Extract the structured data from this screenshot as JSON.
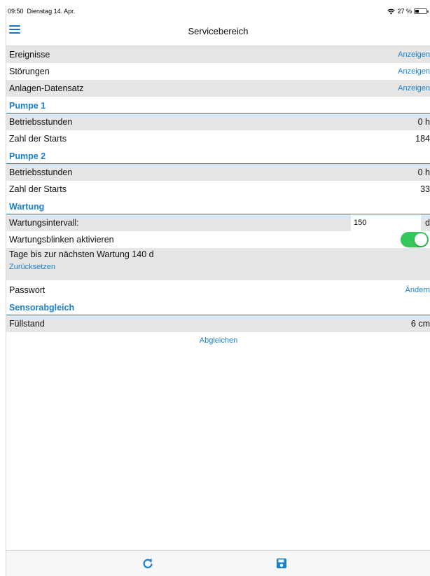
{
  "status_bar": {
    "time": "09:50",
    "date": "Dienstag 14. Apr.",
    "battery_text": "27 %",
    "battery_level": 0.27
  },
  "nav": {
    "title": "Servicebereich"
  },
  "top_rows": [
    {
      "label": "Ereignisse",
      "action": "Anzeigen"
    },
    {
      "label": "Störungen",
      "action": "Anzeigen"
    },
    {
      "label": "Anlagen-Datensatz",
      "action": "Anzeigen"
    }
  ],
  "pumpe1": {
    "title": "Pumpe 1",
    "betriebsstunden_label": "Betriebsstunden",
    "betriebsstunden_value": "0 h",
    "starts_label": "Zahl der Starts",
    "starts_value": "184"
  },
  "pumpe2": {
    "title": "Pumpe 2",
    "betriebsstunden_label": "Betriebsstunden",
    "betriebsstunden_value": "0 h",
    "starts_label": "Zahl der Starts",
    "starts_value": "33"
  },
  "wartung": {
    "title": "Wartung",
    "interval_label": "Wartungsintervall:",
    "interval_value": "150",
    "interval_unit": "d",
    "blink_label": "Wartungsblinken aktivieren",
    "blink_enabled": true,
    "next_text": "Tage bis zur nächsten Wartung 140 d",
    "reset_label": "Zurücksetzen"
  },
  "passwort": {
    "label": "Passwort",
    "action": "Ändern"
  },
  "sensor": {
    "title": "Sensorabgleich",
    "fill_label": "Füllstand",
    "fill_value": "6 cm",
    "calibrate_label": "Abgleichen"
  },
  "colors": {
    "accent": "#1a7fd0",
    "toggle_on": "#34c759",
    "row_grey": "#e5e5e5"
  },
  "icons": {
    "menu": "menu-icon",
    "refresh": "refresh-icon",
    "save": "save-icon",
    "wifi": "wifi-icon",
    "battery": "battery-icon"
  }
}
